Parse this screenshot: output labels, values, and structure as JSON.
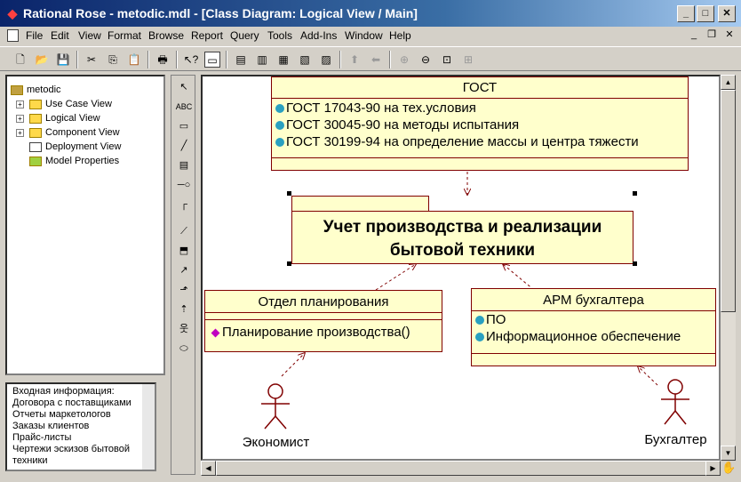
{
  "window": {
    "title": "Rational Rose - metodic.mdl - [Class Diagram: Logical View / Main]",
    "buttons": {
      "minimize": "_",
      "maximize": "□",
      "close": "✕"
    }
  },
  "menu": {
    "items": [
      "File",
      "Edit",
      "View",
      "Format",
      "Browse",
      "Report",
      "Query",
      "Tools",
      "Add-Ins",
      "Window",
      "Help"
    ],
    "mdi": {
      "minimize": "_",
      "restore": "❐",
      "close": "✕"
    }
  },
  "browser": {
    "root": "metodic",
    "items": [
      "Use Case View",
      "Logical View",
      "Component View",
      "Deployment View",
      "Model Properties"
    ]
  },
  "documentation": {
    "lines": [
      "Входная информация:",
      "Договора с поставщиками",
      "Отчеты маркетологов",
      "Заказы клиентов",
      "Прайс-листы",
      "Чертежи эскизов бытовой",
      "техники"
    ]
  },
  "palette": {
    "text_tool": "ABC"
  },
  "diagram": {
    "gost": {
      "name": "ГОСТ",
      "attributes": [
        "ГОСТ 17043-90 на тех.условия",
        "ГОСТ 30045-90 на методы испытания",
        "ГОСТ 30199-94 на определение массы и центра тяжести"
      ]
    },
    "package": {
      "line1": "Учет производства и реализации",
      "line2": "бытовой  техники"
    },
    "planning": {
      "name": "Отдел планирования",
      "operations": [
        "Планирование производства()"
      ]
    },
    "arm": {
      "name": "АРМ бухгалтера",
      "attributes": [
        "ПО",
        "Информационное обеспечение"
      ]
    },
    "actors": {
      "economist": "Экономист",
      "accountant": "Бухгалтер"
    }
  }
}
